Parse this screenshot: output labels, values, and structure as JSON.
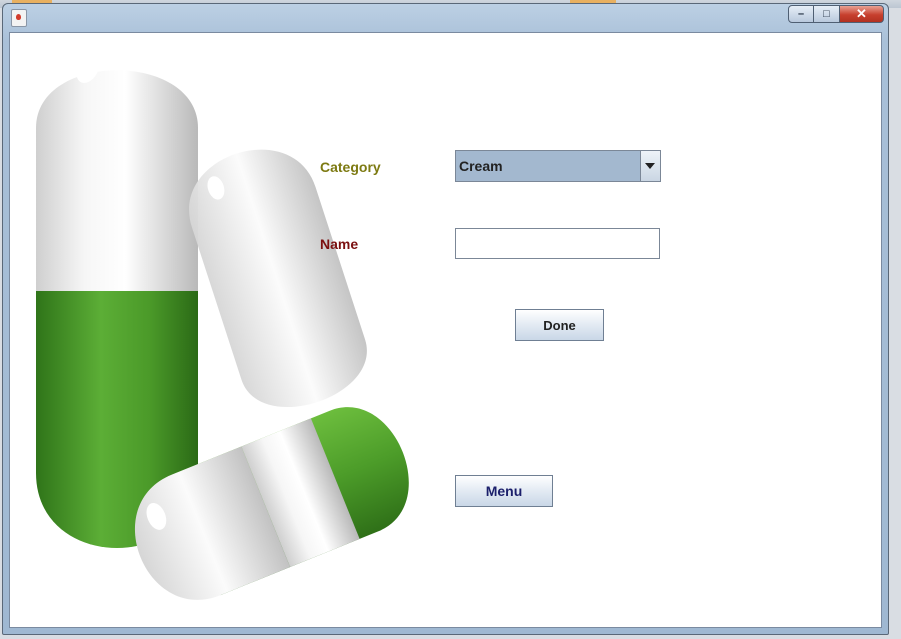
{
  "window": {
    "controls": {
      "minimize_glyph": "–",
      "maximize_glyph": "□",
      "close_glyph": "✕"
    }
  },
  "form": {
    "category_label": "Category",
    "category_value": "Cream",
    "name_label": "Name",
    "name_value": "",
    "done_label": "Done",
    "menu_label": "Menu"
  },
  "colors": {
    "category_label": "#7d7a12",
    "name_label": "#7b1010",
    "combo_background": "#a3b8cf",
    "menu_text": "#1b1f6b",
    "pill_green": "#4f9f2f",
    "close_button": "#c7402e"
  },
  "icons": {
    "app": "java-cup-icon",
    "background": "capsule-pills-image"
  }
}
